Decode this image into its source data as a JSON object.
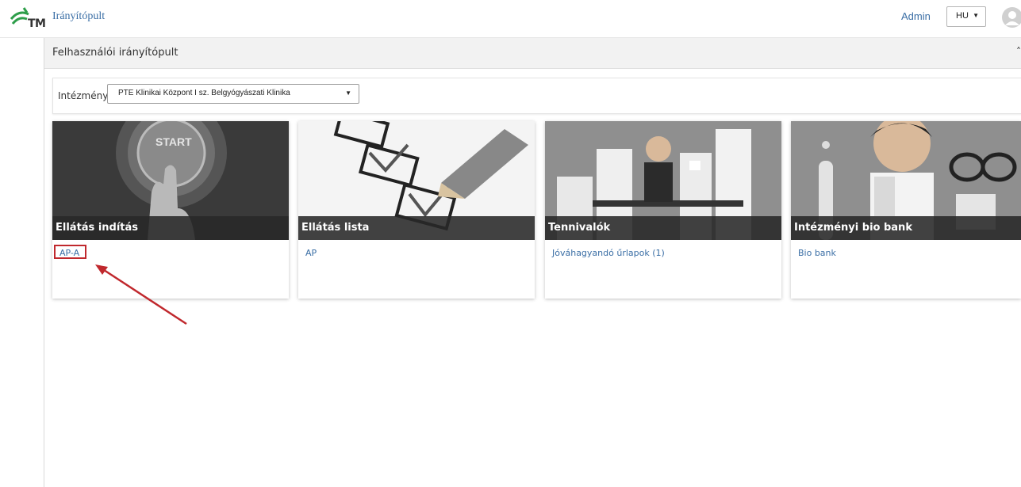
{
  "topbar": {
    "logo_text": "TM",
    "nav_title": "Irányítópult",
    "admin_label": "Admin",
    "language": "HU"
  },
  "page": {
    "section_title": "Felhasználói irányítópult"
  },
  "filter": {
    "label": "Intézmény:",
    "selected": "PTE Klinikai Központ I sz. Belgyógyászati Klinika"
  },
  "cards": [
    {
      "title": "Ellátás indítás",
      "link": "AP-A",
      "image": "start-button-hand",
      "start_text": "START"
    },
    {
      "title": "Ellátás lista",
      "link": "AP",
      "image": "checklist-pencil"
    },
    {
      "title": "Tennivalók",
      "link": "Jóváhagyandó űrlapok (1)",
      "image": "office-worker-papers"
    },
    {
      "title": "Intézményi bio bank",
      "link": "Bio bank",
      "image": "scientist-lab"
    }
  ],
  "colors": {
    "link": "#3a6ea5",
    "band": "#282828",
    "highlight": "#c0282d",
    "header_bg": "#f2f2f2"
  }
}
